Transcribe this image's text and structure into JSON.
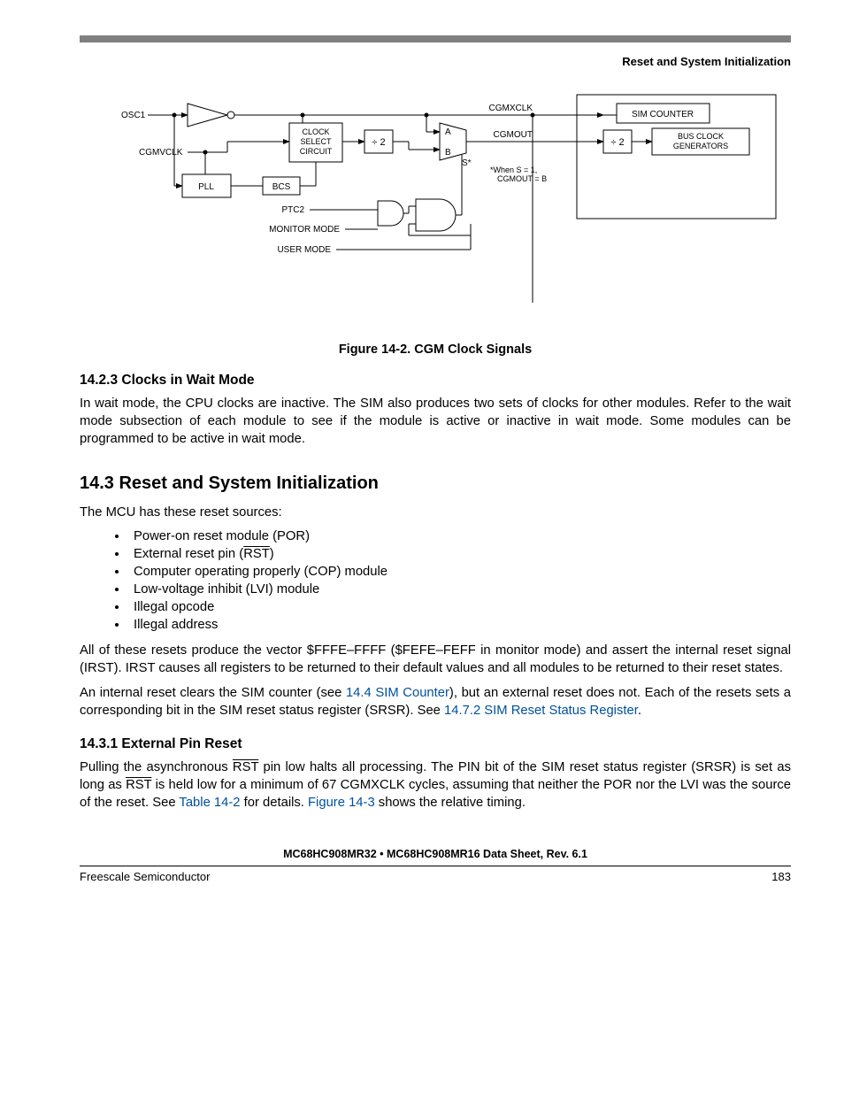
{
  "header": {
    "section_title": "Reset and System Initialization"
  },
  "diagram": {
    "labels": {
      "osc1": "OSC1",
      "cgmvclk": "CGMVCLK",
      "pll": "PLL",
      "clock_select": "CLOCK\nSELECT\nCIRCUIT",
      "bcs": "BCS",
      "ptc2": "PTC2",
      "monitor": "MONITOR MODE",
      "user": "USER MODE",
      "div2_a": "÷ 2",
      "a": "A",
      "b": "B",
      "sstar": "S*",
      "cgmxclk": "CGMXCLK",
      "cgmout": "CGMOUT",
      "when_note": "*When S = 1,\nCGMOUT = B",
      "sim_counter": "SIM COUNTER",
      "div2_b": "÷ 2",
      "bus_gen": "BUS CLOCK\nGENERATORS"
    },
    "caption": "Figure 14-2. CGM Clock Signals"
  },
  "subsection_14_2_3": {
    "title": "14.2.3  Clocks in Wait Mode",
    "body": "In wait mode, the CPU clocks are inactive. The SIM also produces two sets of clocks for other modules. Refer to the wait mode subsection of each module to see if the module is active or inactive in wait mode. Some modules can be programmed to be active in wait mode."
  },
  "section_14_3": {
    "title": "14.3  Reset and System Initialization",
    "intro": "The MCU has these reset sources:",
    "bullets": [
      "Power-on reset module (POR)",
      "External reset pin (RST)",
      "Computer operating properly (COP) module",
      "Low-voltage inhibit (LVI) module",
      "Illegal opcode",
      "Illegal address"
    ],
    "para2": "All of these resets produce the vector $FFFE–FFFF ($FEFE–FEFF in monitor mode) and assert the internal reset signal (IRST). IRST causes all registers to be returned to their default values and all modules to be returned to their reset states.",
    "para3_pre": "An internal reset clears the SIM counter (see ",
    "para3_link1": "14.4 SIM Counter",
    "para3_mid": "), but an external reset does not. Each of the resets sets a corresponding bit in the SIM reset status register (SRSR). See ",
    "para3_link2": "14.7.2 SIM Reset Status Register",
    "para3_end": "."
  },
  "subsection_14_3_1": {
    "title": "14.3.1  External Pin Reset",
    "para_pre": "Pulling the asynchronous ",
    "rst1": "RST",
    "para_mid1": " pin low halts all processing. The PIN bit of the SIM reset status register (SRSR) is set as long as ",
    "rst2": "RST",
    "para_mid2": " is held low for a minimum of 67 CGMXCLK cycles, assuming that neither the POR nor the LVI was the source of the reset. See ",
    "link_table": "Table 14-2",
    "para_mid3": " for details. ",
    "link_fig": "Figure 14-3",
    "para_end": " shows the relative timing."
  },
  "footer": {
    "doc_title": "MC68HC908MR32 • MC68HC908MR16 Data Sheet, Rev. 6.1",
    "company": "Freescale Semiconductor",
    "page": "183"
  }
}
